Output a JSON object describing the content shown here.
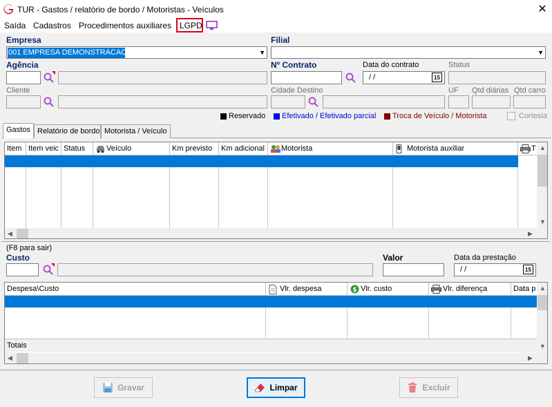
{
  "window": {
    "title": "TUR - Gastos / relatório de bordo / Motoristas - Veículos",
    "close_glyph": "✕"
  },
  "menu": {
    "items": [
      "Saída",
      "Cadastros",
      "Procedimentos auxiliares",
      "LGPD"
    ],
    "highlight_color": "#e0001b",
    "extra_icon": "monitor-icon"
  },
  "form": {
    "empresa": {
      "label": "Empresa",
      "value": "001 EMPRESA DEMONSTRACAO"
    },
    "filial": {
      "label": "Filial",
      "value": ""
    },
    "agencia": {
      "label": "Agência"
    },
    "contrato": {
      "label": "Nº Contrato"
    },
    "data_contrato": {
      "label": "Data do contrato",
      "value": " / /"
    },
    "status": {
      "label": "Status"
    },
    "cliente": {
      "label": "Cliente"
    },
    "cidade_destino": {
      "label": "Cidade Destino"
    },
    "uf": {
      "label": "UF"
    },
    "qtd_diarias": {
      "label": "Qtd diárias"
    },
    "qtd_carro": {
      "label": "Qtd carro"
    }
  },
  "legend": {
    "items": [
      {
        "label": "Reservado",
        "color": "#000000",
        "text_color": "#000000"
      },
      {
        "label": "Efetivado / Efetivado parcial",
        "color": "#0000ff",
        "text_color": "#0000cc"
      },
      {
        "label": "Troca de Veículo / Motorista",
        "color": "#800000",
        "text_color": "#800000"
      }
    ],
    "cortesia": {
      "label": "Cortesia",
      "checked": false
    }
  },
  "tabs": [
    {
      "label": "Gastos",
      "active": true
    },
    {
      "label": "Relatório de bordo",
      "active": false
    },
    {
      "label": "Motorista / Veículo",
      "active": false
    }
  ],
  "grid1": {
    "columns": [
      "Item",
      "Item veic",
      "Status",
      "Veículo",
      "Km previsto",
      "Km adicional",
      "Motorista",
      "Motorista auxiliar",
      "T"
    ]
  },
  "custo_section": {
    "hint": "(F8 para sair)",
    "custo_label": "Custo",
    "valor_label": "Valor",
    "data_prestacao_label": "Data da prestação",
    "data_prestacao_value": " / /",
    "calendar_glyph": "15"
  },
  "grid2": {
    "columns": [
      "Despesa\\Custo",
      "Vlr. despesa",
      "Vlr. custo",
      "Vlr. diferença",
      "Data p"
    ],
    "footer_label": "Totais"
  },
  "buttons": {
    "gravar": "Gravar",
    "limpar": "Limpar",
    "excluir": "Excluir"
  },
  "colors": {
    "selection": "#0078d7",
    "label_blue": "#0a246a",
    "search_icon": "#b050d0"
  }
}
